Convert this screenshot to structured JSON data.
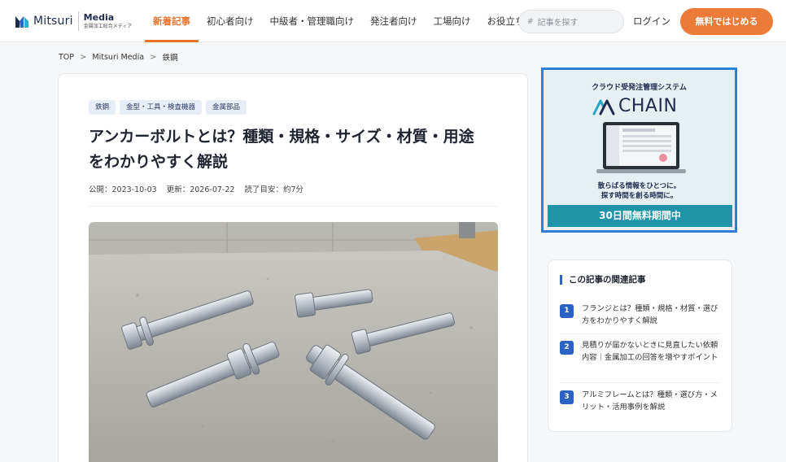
{
  "header": {
    "logo_word": "Mitsuri",
    "logo_media": "Media",
    "logo_tagline": "金属加工総合メディア",
    "nav": [
      {
        "label": "新着記事",
        "active": true
      },
      {
        "label": "初心者向け",
        "active": false
      },
      {
        "label": "中級者・管理職向け",
        "active": false
      },
      {
        "label": "発注者向け",
        "active": false
      },
      {
        "label": "工場向け",
        "active": false
      },
      {
        "label": "お役立ち資料",
        "active": false
      }
    ],
    "search_placeholder": "記事を探す",
    "login_label": "ログイン",
    "cta_label": "無料ではじめる"
  },
  "breadcrumb": [
    "TOP",
    "Mitsuri Media",
    "鉄鋼"
  ],
  "article": {
    "tags": [
      "鉄鋼",
      "金型・工具・検査機器",
      "金属部品"
    ],
    "title_line1": "アンカーボルトとは？種類・規格・サイズ・材質・用途",
    "title_line2": "をわかりやすく解説",
    "published": "公開：2023-10-03",
    "updated": "更新：2026-07-22",
    "read_time": "読了目安：約7分"
  },
  "ad": {
    "heading": "クラウド受発注管理システム",
    "brand": "CHAIN",
    "copy_line1": "散らばる情報をひとつに。",
    "copy_line2": "探す時間を創る時間に。",
    "banner": "30日間無料期間中"
  },
  "related": {
    "title": "この記事の関連記事",
    "items": [
      {
        "num": "1",
        "text": "フランジとは？種類・規格・材質・選び方をわかりやすく解説"
      },
      {
        "num": "2",
        "text": "見積りが届かないときに見直したい依頼内容｜金属加工の回答を増やすポイント"
      },
      {
        "num": "3",
        "text": "アルミフレームとは？種類・選び方・メリット・活用事例を解説"
      }
    ]
  },
  "colors": {
    "accent": "#e8742f",
    "cta": "#ec7a38",
    "brand_navy": "#1d2b4f",
    "related_blue": "#2a63c4",
    "ad_border": "#2f7fd8",
    "ad_banner": "#1f93a7"
  }
}
